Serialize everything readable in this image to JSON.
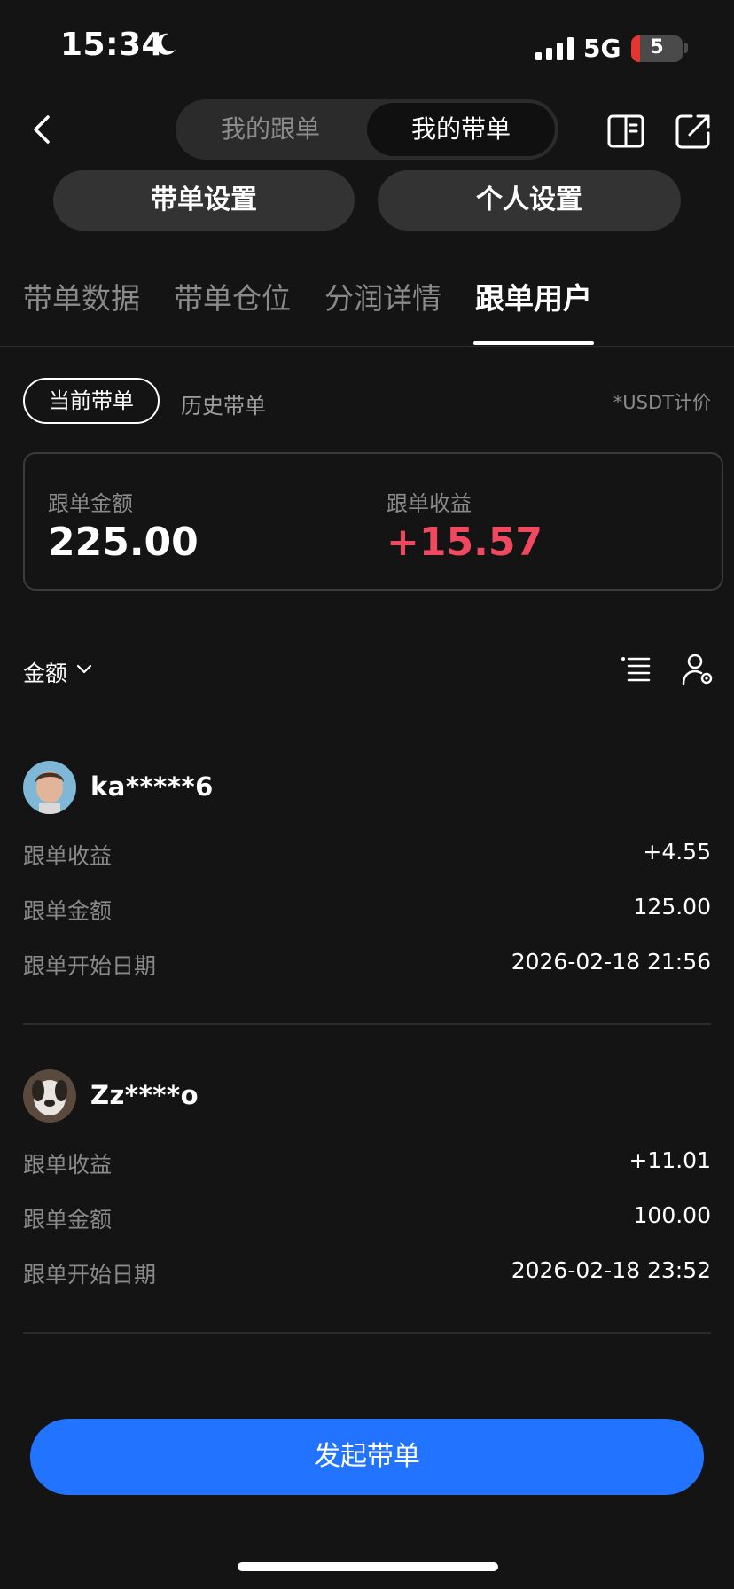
{
  "status_bar": {
    "time": "15:34",
    "network": "5G",
    "battery": "5"
  },
  "header": {
    "segments": [
      "我的跟单",
      "我的带单"
    ],
    "active_segment": "我的带单"
  },
  "settings": {
    "lead_settings": "带单设置",
    "personal_settings": "个人设置"
  },
  "tabs": [
    {
      "label": "带单数据"
    },
    {
      "label": "带单仓位"
    },
    {
      "label": "分润详情"
    },
    {
      "label": "跟单用户"
    }
  ],
  "filters": {
    "current": "当前带单",
    "history": "历史带单",
    "unit_note": "*USDT计价"
  },
  "summary": {
    "amount_label": "跟单金额",
    "amount_value": "225.00",
    "profit_label": "跟单收益",
    "profit_value": "+15.57"
  },
  "sort": {
    "label": "金额"
  },
  "followers": [
    {
      "name": "ka*****6",
      "profit_label": "跟单收益",
      "profit_value": "+4.55",
      "amount_label": "跟单金额",
      "amount_value": "125.00",
      "start_label": "跟单开始日期",
      "start_value": "2026-02-18 21:56"
    },
    {
      "name": "Zz****o",
      "profit_label": "跟单收益",
      "profit_value": "+11.01",
      "amount_label": "跟单金额",
      "amount_value": "100.00",
      "start_label": "跟单开始日期",
      "start_value": "2026-02-18 23:52"
    }
  ],
  "cta": {
    "label": "发起带单"
  },
  "colors": {
    "background": "#141414",
    "accent": "#2273ff",
    "positive": "#f0485e",
    "muted": "#8a8a8a"
  },
  "icons": {
    "back": "chevron-left-icon",
    "book": "book-icon",
    "share": "share-icon",
    "list": "list-icon",
    "user_settings": "user-gear-icon"
  }
}
